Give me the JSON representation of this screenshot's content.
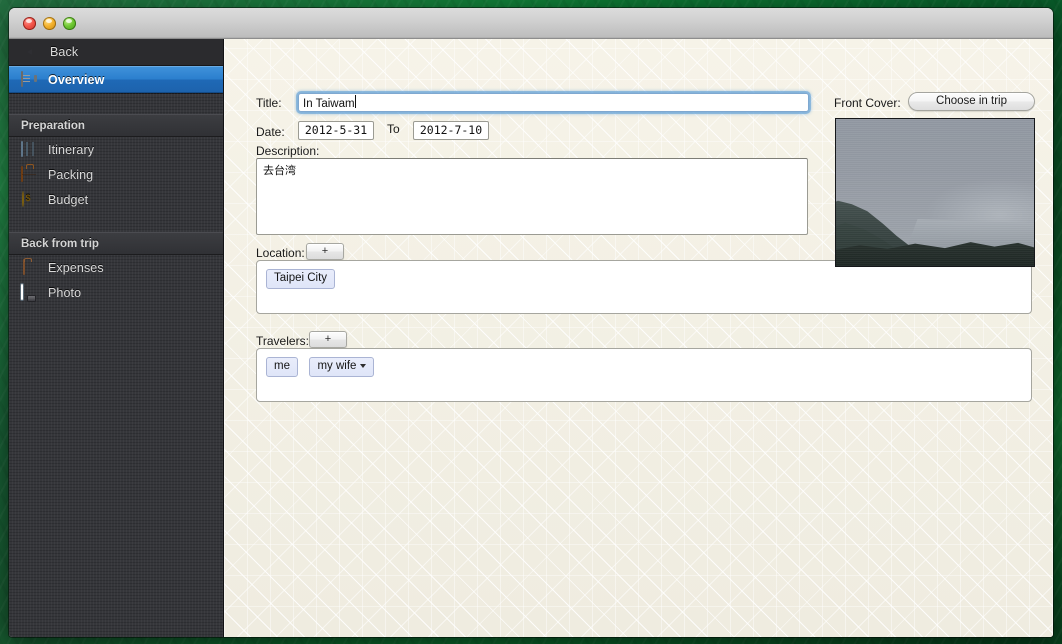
{
  "window": {
    "traffic_lights": [
      "close",
      "minimize",
      "zoom"
    ]
  },
  "sidebar": {
    "back": {
      "label": "Back",
      "icon": "back-arrow-icon"
    },
    "items_top": [
      {
        "label": "Overview",
        "icon": "overview-document-icon",
        "selected": true
      }
    ],
    "sections": [
      {
        "header": "Preparation",
        "items": [
          {
            "label": "Itinerary",
            "icon": "map-icon"
          },
          {
            "label": "Packing",
            "icon": "suitcase-icon"
          },
          {
            "label": "Budget",
            "icon": "money-bag-icon"
          }
        ]
      },
      {
        "header": "Back from trip",
        "items": [
          {
            "label": "Expenses",
            "icon": "receipt-icon"
          },
          {
            "label": "Photo",
            "icon": "photo-camera-icon"
          }
        ]
      }
    ]
  },
  "form": {
    "title": {
      "label": "Title:",
      "value": "In Taiwam",
      "placeholder": ""
    },
    "date": {
      "label": "Date:",
      "start": "2012-5-31",
      "separator": "To",
      "end": "2012-7-10"
    },
    "description": {
      "label": "Description:",
      "value": "去台湾",
      "placeholder": ""
    },
    "location": {
      "label": "Location:",
      "add_label": "+",
      "tokens": [
        {
          "label": "Taipei City",
          "has_menu": false
        }
      ]
    },
    "travelers": {
      "label": "Travelers:",
      "add_label": "+",
      "tokens": [
        {
          "label": "me",
          "has_menu": false
        },
        {
          "label": "my wife",
          "has_menu": true
        }
      ]
    },
    "front_cover": {
      "label": "Front Cover:",
      "button_label": "Choose in trip",
      "image_alt": "misty-lake-landscape"
    }
  },
  "colors": {
    "accent_selected": "#2b7fce",
    "sidebar_bg": "#35363a",
    "paper_bg": "#f2efe2",
    "token_bg": "#e4e9f8",
    "token_border": "#aab4d4"
  }
}
